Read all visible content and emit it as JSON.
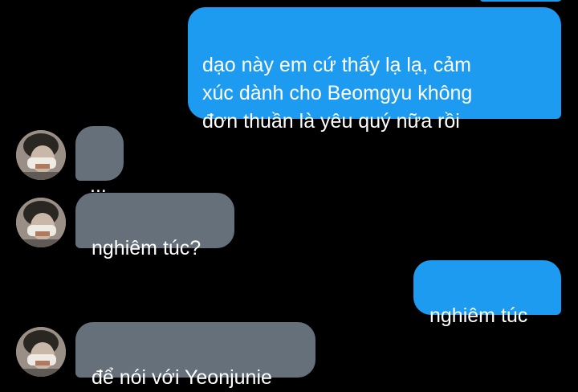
{
  "conversation": {
    "messages": [
      {
        "direction": "outgoing",
        "text": "dạo này em cứ thấy lạ lạ, cảm\nxúc dành cho Beomgyu không\nđơn thuần là yêu quý nữa rồi"
      },
      {
        "direction": "incoming",
        "text": "..."
      },
      {
        "direction": "incoming",
        "text": "nghiêm túc?"
      },
      {
        "direction": "outgoing",
        "text": "nghiêm túc"
      },
      {
        "direction": "incoming",
        "text": "để nói với Yeonjunie"
      }
    ]
  },
  "colors": {
    "outgoing_bubble": "#1d9bf0",
    "incoming_bubble": "#66707b",
    "background": "#000000",
    "text": "#ffffff"
  },
  "icons": {
    "avatar": "contact-avatar-photo"
  }
}
